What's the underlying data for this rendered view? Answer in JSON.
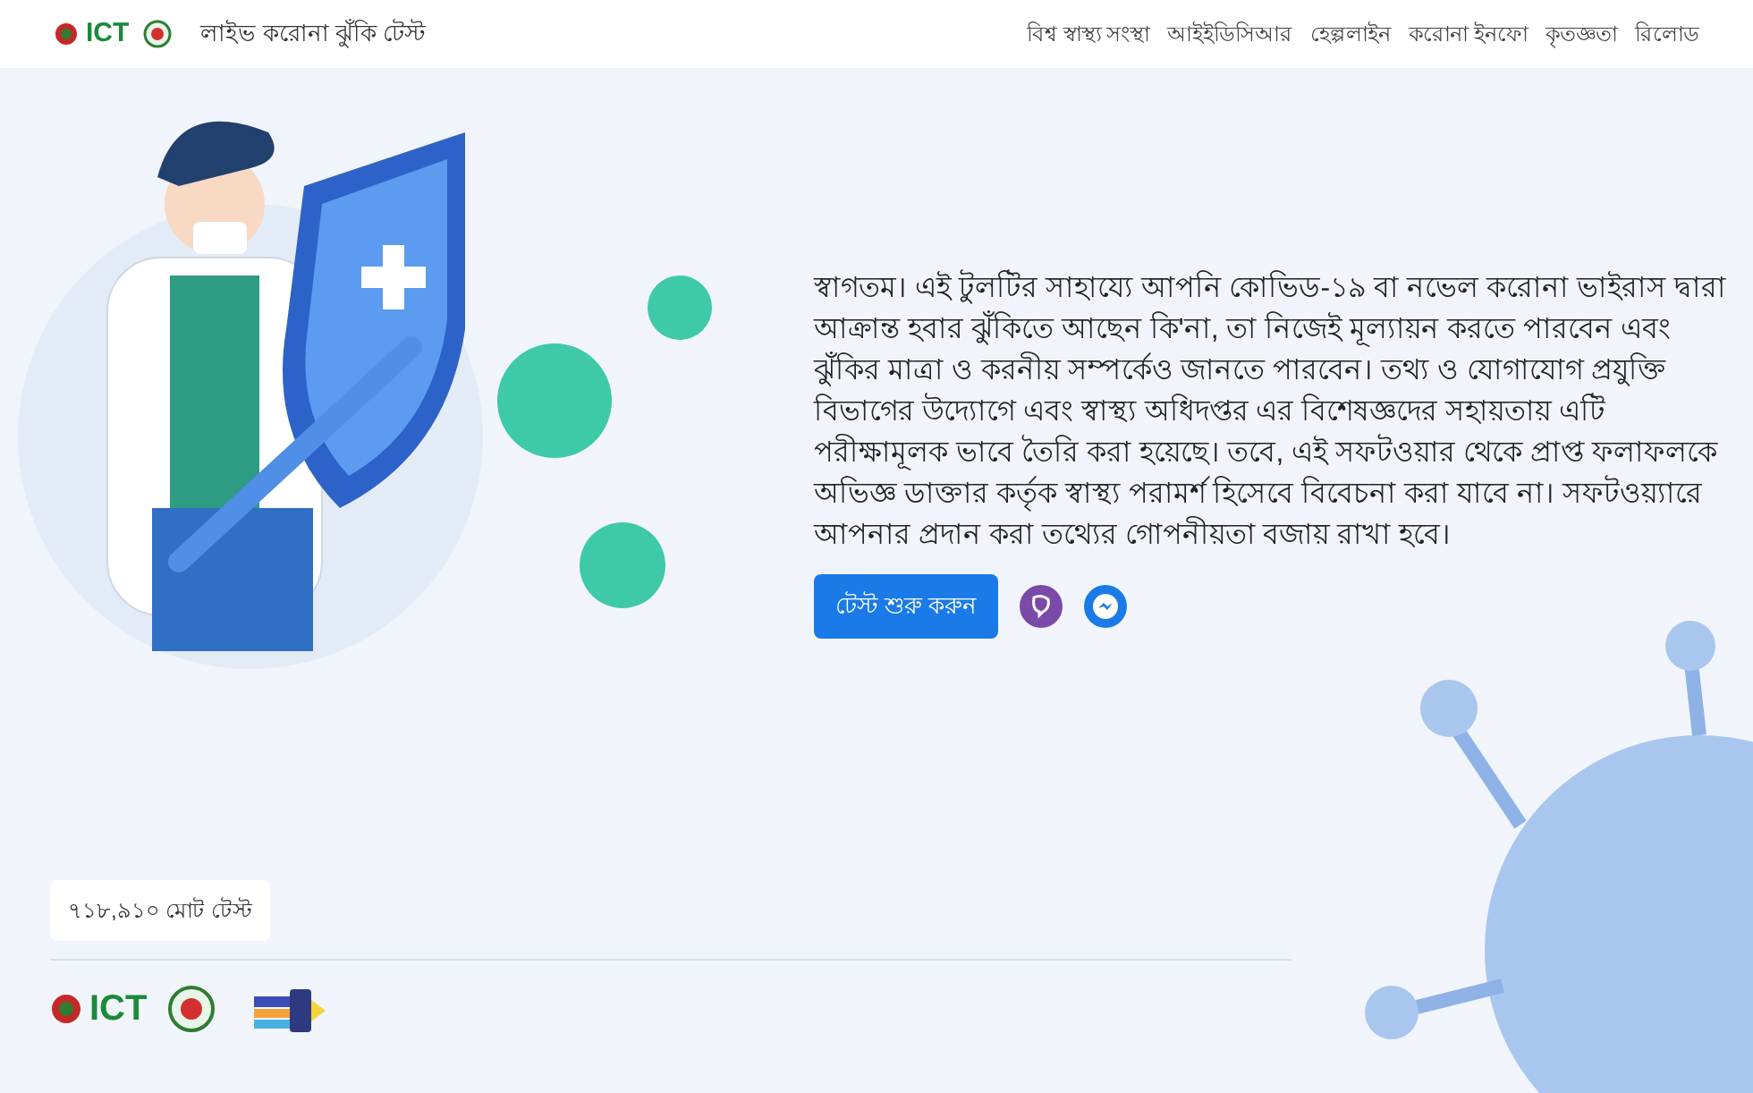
{
  "header": {
    "logo_text": "ICT",
    "title": "লাইভ করোনা ঝুঁকি টেস্ট",
    "nav": [
      "বিশ্ব স্বাস্থ্য সংস্থা",
      "আইইডিসিআর",
      "হেল্পলাইন",
      "করোনা ইনফো",
      "কৃতজ্ঞতা",
      "রিলোড"
    ]
  },
  "intro": "স্বাগতম। এই টুলটির সাহায্যে আপনি কোভিড-১৯ বা নভেল করোনা ভাইরাস দ্বারা আক্রান্ত হবার ঝুঁকিতে আছেন কি'না, তা নিজেই মূল্যায়ন করতে পারবেন এবং ঝুঁকির মাত্রা ও করনীয় সম্পর্কেও জানতে পারবেন। তথ্য ও যোগাযোগ প্রযুক্তি বিভাগের উদ্যোগে এবং স্বাস্থ্য অধিদপ্তর এর বিশেষজ্ঞদের সহায়তায় এটি পরীক্ষামূলক ভাবে তৈরি করা হয়েছে। তবে, এই সফটওয়ার থেকে প্রাপ্ত ফলাফলকে অভিজ্ঞ ডাক্তার কর্তৃক স্বাস্থ্য পরামর্শ হিসেবে বিবেচনা করা যাবে না। সফটওয়্যারে আপনার প্রদান করা তথ্যের গোপনীয়তা বজায় রাখা হবে।",
  "start_button": "টেস্ট শুরু করুন",
  "counter": "৭১৮,৯১০ মোট টেস্ট",
  "footer": {
    "logo_text": "ICT"
  }
}
